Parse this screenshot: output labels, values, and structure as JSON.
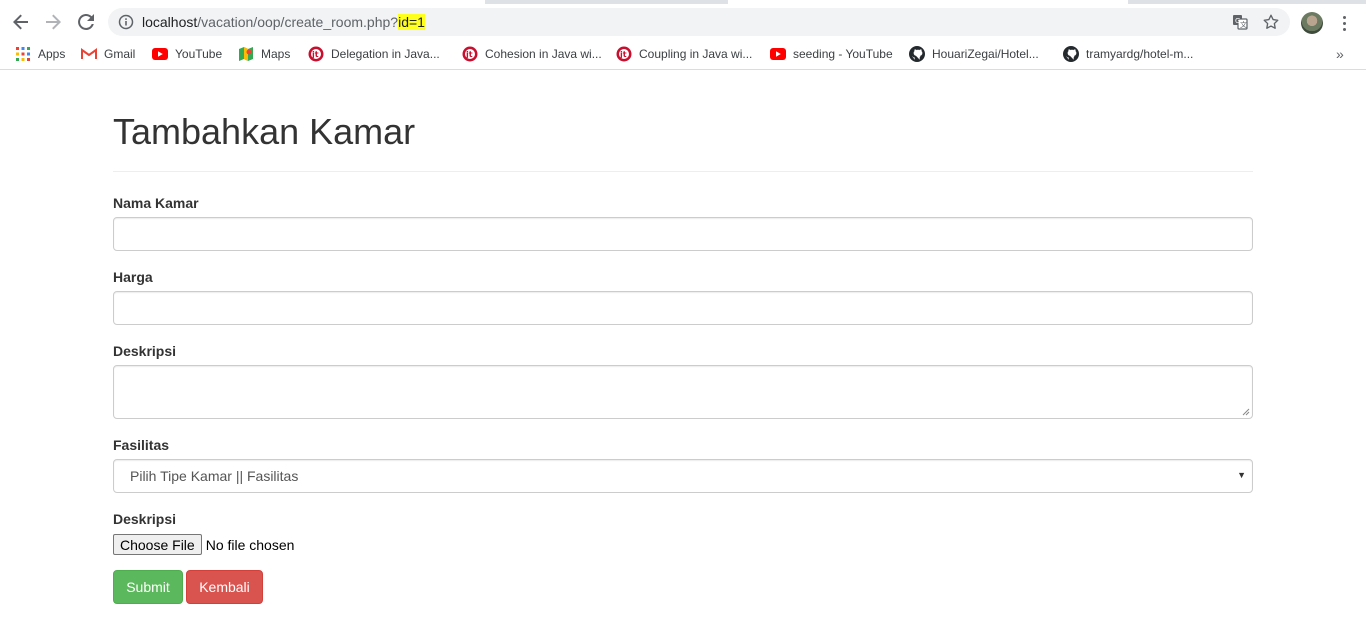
{
  "browser": {
    "url_host": "localhost",
    "url_path": "/vacation/oop/create_room.php?",
    "url_highlight": "id=1"
  },
  "bookmarks": [
    {
      "label": "Apps",
      "icon": "apps-grid-icon"
    },
    {
      "label": "Gmail",
      "icon": "gmail-icon"
    },
    {
      "label": "YouTube",
      "icon": "youtube-icon"
    },
    {
      "label": "Maps",
      "icon": "maps-icon"
    },
    {
      "label": "Delegation in Java...",
      "icon": "javatpoint-icon"
    },
    {
      "label": "Cohesion in Java wi...",
      "icon": "javatpoint-icon"
    },
    {
      "label": "Coupling in Java wi...",
      "icon": "javatpoint-icon"
    },
    {
      "label": "seeding - YouTube",
      "icon": "youtube-icon"
    },
    {
      "label": "HouariZegai/Hotel...",
      "icon": "github-icon"
    },
    {
      "label": "tramyardg/hotel-m...",
      "icon": "github-icon"
    }
  ],
  "bookmarks_more": "»",
  "form": {
    "title": "Tambahkan Kamar",
    "nama_label": "Nama Kamar",
    "nama_value": "",
    "harga_label": "Harga",
    "harga_value": "",
    "deskripsi_label": "Deskripsi",
    "deskripsi_value": "",
    "fasilitas_label": "Fasilitas",
    "fasilitas_selected": "Pilih Tipe Kamar || Fasilitas",
    "file_label": "Deskripsi",
    "file_button": "Choose File",
    "file_status": "No file chosen",
    "submit_label": "Submit",
    "back_label": "Kembali"
  },
  "colors": {
    "submit": "#5cb85c",
    "back": "#d9534f",
    "url_highlight": "#ffff1e"
  }
}
